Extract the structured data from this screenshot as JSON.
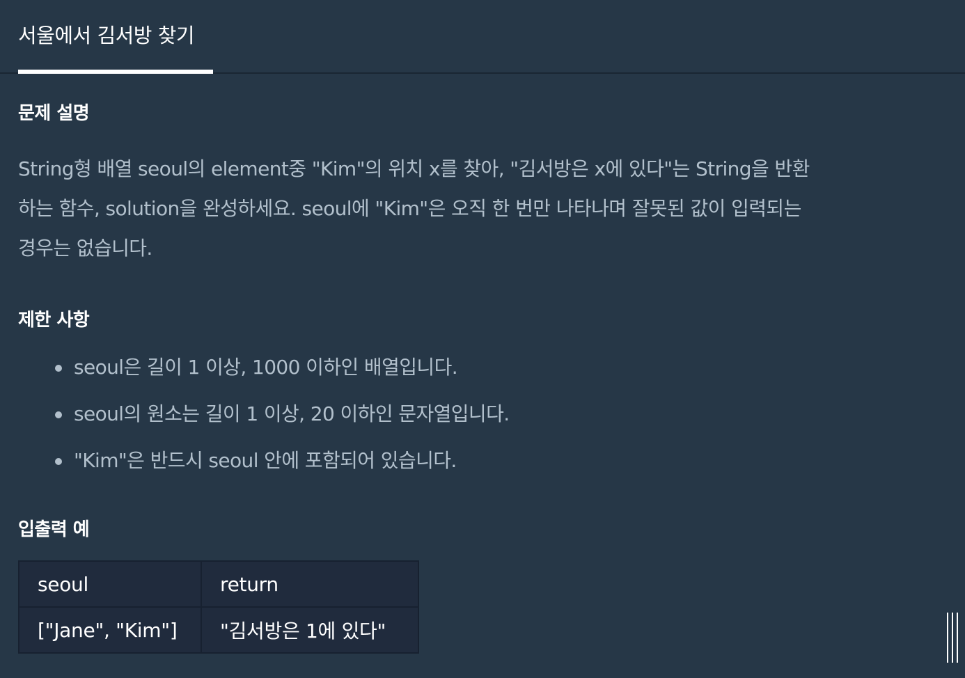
{
  "tab": {
    "title": "서울에서 김서방 찾기"
  },
  "sections": {
    "description": {
      "heading": "문제 설명",
      "line1": "String형 배열 seoul의 element중 \"Kim\"의 위치 x를 찾아, \"김서방은 x에 있다\"는 String을 반환",
      "line2": "하는 함수, solution을 완성하세요. seoul에 \"Kim\"은 오직 한 번만 나타나며 잘못된 값이 입력되는",
      "line3": "경우는 없습니다."
    },
    "constraints": {
      "heading": "제한 사항",
      "items": [
        "seoul은 길이 1 이상, 1000 이하인 배열입니다.",
        "seoul의 원소는 길이 1 이상, 20 이하인 문자열입니다.",
        "\"Kim\"은 반드시 seoul 안에 포함되어 있습니다."
      ]
    },
    "examples": {
      "heading": "입출력 예",
      "columns": [
        "seoul",
        "return"
      ],
      "rows": [
        [
          "[\"Jane\", \"Kim\"]",
          "\"김서방은 1에 있다\""
        ]
      ]
    }
  },
  "icons": {
    "resize_handle": "vertical-resize-handle-icon"
  }
}
